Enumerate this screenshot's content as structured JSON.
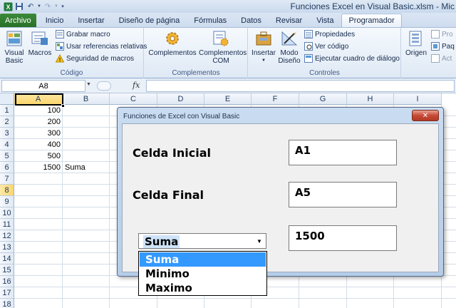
{
  "window": {
    "title": "Funciones Excel en Visual Basic.xlsm - Mic"
  },
  "ribbon_tabs": [
    "Archivo",
    "Inicio",
    "Insertar",
    "Diseño de página",
    "Fórmulas",
    "Datos",
    "Revisar",
    "Vista",
    "Programador"
  ],
  "active_tab": "Programador",
  "ribbon": {
    "codigo": {
      "label": "Código",
      "visual_basic": "Visual Basic",
      "macros": "Macros",
      "grabar_macro": "Grabar macro",
      "usar_referencias": "Usar referencias relativas",
      "seguridad": "Seguridad de macros"
    },
    "complementos": {
      "label": "Complementos",
      "complementos": "Complementos",
      "complementos_com": "Complementos COM"
    },
    "controles": {
      "label": "Controles",
      "insertar": "Insertar",
      "modo_diseno": "Modo Diseño",
      "propiedades": "Propiedades",
      "ver_codigo": "Ver código",
      "ejecutar_cuadro": "Ejecutar cuadro de diálogo"
    },
    "xml": {
      "origen": "Origen",
      "pro": "Pro",
      "paq": "Paq",
      "act": "Act"
    }
  },
  "formula_bar": {
    "name_box": "A8",
    "fx": "fx",
    "value": ""
  },
  "grid": {
    "columns": [
      "A",
      "B",
      "C",
      "D",
      "E",
      "F",
      "G",
      "H",
      "I"
    ],
    "rows": [
      "1",
      "2",
      "3",
      "4",
      "5",
      "6",
      "7",
      "8",
      "9",
      "10",
      "11",
      "12",
      "13",
      "14",
      "15",
      "16",
      "17",
      "18"
    ],
    "selected_column": "A",
    "selected_row": "8",
    "col_a": [
      "100",
      "200",
      "300",
      "400",
      "500",
      "1500"
    ],
    "b6": "Suma"
  },
  "dialog": {
    "title": "Funciones de Excel con Visual Basic",
    "close": "✕",
    "label_inicial": "Celda Inicial",
    "label_final": "Celda Final",
    "value_inicial": "A1",
    "value_final": "A5",
    "value_result": "1500",
    "combo_value": "Suma",
    "options": [
      "Suma",
      "Minimo",
      "Maximo"
    ],
    "highlighted_option": "Suma"
  },
  "colors": {
    "file_tab": "#2a7028",
    "selection_header": "#f9d66e",
    "highlight": "#3399ff",
    "close_button": "#c64a36"
  }
}
